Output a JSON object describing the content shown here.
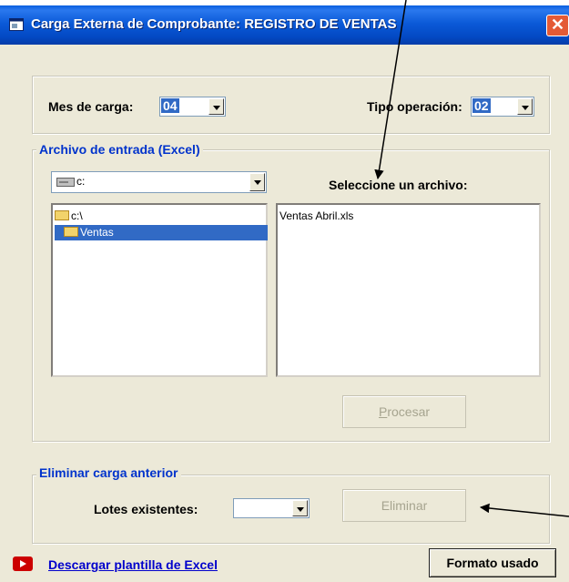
{
  "window": {
    "title": "Carga Externa de Comprobante: REGISTRO DE VENTAS",
    "close_glyph": "✕"
  },
  "header": {
    "mes_label": "Mes de carga:",
    "mes_value": "04",
    "tipo_label": "Tipo operación:",
    "tipo_value": "02"
  },
  "archivo": {
    "legend": "Archivo de entrada (Excel)",
    "drive_value": "c:",
    "folders": [
      {
        "label": "c:\\",
        "selected": false
      },
      {
        "label": "Ventas",
        "selected": true
      }
    ],
    "files_heading": "Seleccione un archivo:",
    "files": [
      "Ventas Abril.xls"
    ],
    "procesar_first": "P",
    "procesar_rest": "rocesar"
  },
  "eliminar": {
    "legend": "Eliminar carga anterior",
    "lotes_label": "Lotes existentes:",
    "lotes_value": "",
    "eliminar_button": "Eliminar"
  },
  "footer": {
    "link": "Descargar plantilla de Excel",
    "formato_button": "Formato usado",
    "video_icon_color": "#cc0000"
  },
  "colors": {
    "titlebar": "#0349c4",
    "legend": "#0033cc",
    "selection": "#316ac5",
    "window_bg": "#ece9d8"
  }
}
